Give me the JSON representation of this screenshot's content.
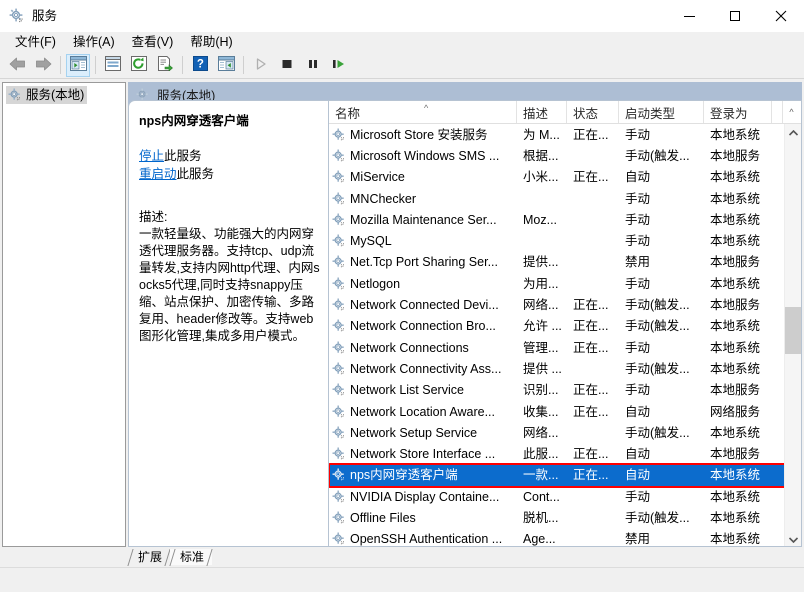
{
  "window": {
    "title": "服务",
    "icon": "services-gear-icon",
    "minimize": "−",
    "maximize": "□",
    "close": "✕"
  },
  "menubar": {
    "items": [
      {
        "label": "文件(F)",
        "name": "menu-file"
      },
      {
        "label": "操作(A)",
        "name": "menu-action"
      },
      {
        "label": "查看(V)",
        "name": "menu-view"
      },
      {
        "label": "帮助(H)",
        "name": "menu-help"
      }
    ]
  },
  "toolbar": {
    "buttons": [
      {
        "name": "back-icon",
        "title": "后退"
      },
      {
        "name": "forward-icon",
        "title": "前进"
      },
      {
        "name": "show-tree-icon",
        "title": "显示/隐藏控制台树"
      },
      {
        "name": "properties-icon",
        "title": "属性"
      },
      {
        "name": "refresh-icon",
        "title": "刷新"
      },
      {
        "name": "export-list-icon",
        "title": "导出列表"
      },
      {
        "name": "help-icon",
        "title": "帮助"
      },
      {
        "name": "show-action-pane-icon",
        "title": "显示/隐藏操作窗格"
      },
      {
        "name": "start-service-icon",
        "title": "启动服务"
      },
      {
        "name": "stop-service-icon",
        "title": "停止服务"
      },
      {
        "name": "pause-service-icon",
        "title": "暂停服务"
      },
      {
        "name": "restart-service-icon",
        "title": "重启动服务"
      }
    ]
  },
  "tree": {
    "root_label": "服务(本地)",
    "root_icon": "services-gear-icon"
  },
  "pane": {
    "header_label": "服务(本地)",
    "header_icon": "services-gear-icon"
  },
  "details": {
    "service_name": "nps内网穿透客户端",
    "links": [
      {
        "link_text": "停止",
        "suffix": "此服务",
        "name": "stop-service-link"
      },
      {
        "link_text": "重启动",
        "suffix": "此服务",
        "name": "restart-service-link"
      }
    ],
    "description_label": "描述:",
    "description_text": "一款轻量级、功能强大的内网穿透代理服务器。支持tcp、udp流量转发,支持内网http代理、内网socks5代理,同时支持snappy压缩、站点保护、加密传输、多路复用、header修改等。支持web图形化管理,集成多用户模式。"
  },
  "list": {
    "columns": [
      {
        "key": "name",
        "label": "名称",
        "sorted": "asc",
        "sort_glyph": "^"
      },
      {
        "key": "desc",
        "label": "描述"
      },
      {
        "key": "state",
        "label": "状态"
      },
      {
        "key": "start",
        "label": "启动类型"
      },
      {
        "key": "logon",
        "label": "登录为"
      }
    ],
    "scroll_cap_glyph": "^",
    "rows": [
      {
        "name": "Microsoft Store 安装服务",
        "desc": "为 M...",
        "state": "正在...",
        "start": "手动",
        "logon": "本地系统",
        "selected": false
      },
      {
        "name": "Microsoft Windows SMS ...",
        "desc": "根据...",
        "state": "",
        "start": "手动(触发...",
        "logon": "本地服务",
        "selected": false
      },
      {
        "name": "MiService",
        "desc": "小米...",
        "state": "正在...",
        "start": "自动",
        "logon": "本地系统",
        "selected": false
      },
      {
        "name": "MNChecker",
        "desc": "",
        "state": "",
        "start": "手动",
        "logon": "本地系统",
        "selected": false
      },
      {
        "name": "Mozilla Maintenance Ser...",
        "desc": "Moz...",
        "state": "",
        "start": "手动",
        "logon": "本地系统",
        "selected": false
      },
      {
        "name": "MySQL",
        "desc": "",
        "state": "",
        "start": "手动",
        "logon": "本地系统",
        "selected": false
      },
      {
        "name": "Net.Tcp Port Sharing Ser...",
        "desc": "提供...",
        "state": "",
        "start": "禁用",
        "logon": "本地服务",
        "selected": false
      },
      {
        "name": "Netlogon",
        "desc": "为用...",
        "state": "",
        "start": "手动",
        "logon": "本地系统",
        "selected": false
      },
      {
        "name": "Network Connected Devi...",
        "desc": "网络...",
        "state": "正在...",
        "start": "手动(触发...",
        "logon": "本地服务",
        "selected": false
      },
      {
        "name": "Network Connection Bro...",
        "desc": "允许 ...",
        "state": "正在...",
        "start": "手动(触发...",
        "logon": "本地系统",
        "selected": false
      },
      {
        "name": "Network Connections",
        "desc": "管理...",
        "state": "正在...",
        "start": "手动",
        "logon": "本地系统",
        "selected": false
      },
      {
        "name": "Network Connectivity Ass...",
        "desc": "提供 ...",
        "state": "",
        "start": "手动(触发...",
        "logon": "本地系统",
        "selected": false
      },
      {
        "name": "Network List Service",
        "desc": "识别...",
        "state": "正在...",
        "start": "手动",
        "logon": "本地服务",
        "selected": false
      },
      {
        "name": "Network Location Aware...",
        "desc": "收集...",
        "state": "正在...",
        "start": "自动",
        "logon": "网络服务",
        "selected": false
      },
      {
        "name": "Network Setup Service",
        "desc": "网络...",
        "state": "",
        "start": "手动(触发...",
        "logon": "本地系统",
        "selected": false
      },
      {
        "name": "Network Store Interface ...",
        "desc": "此服...",
        "state": "正在...",
        "start": "自动",
        "logon": "本地服务",
        "selected": false
      },
      {
        "name": "nps内网穿透客户端",
        "desc": "一款...",
        "state": "正在...",
        "start": "自动",
        "logon": "本地系统",
        "selected": true
      },
      {
        "name": "NVIDIA Display Containe...",
        "desc": "Cont...",
        "state": "",
        "start": "手动",
        "logon": "本地系统",
        "selected": false
      },
      {
        "name": "Offline Files",
        "desc": "脱机...",
        "state": "",
        "start": "手动(触发...",
        "logon": "本地系统",
        "selected": false
      },
      {
        "name": "OpenSSH Authentication ...",
        "desc": "Age...",
        "state": "",
        "start": "禁用",
        "logon": "本地系统",
        "selected": false
      }
    ]
  },
  "tabs": [
    {
      "label": "扩展",
      "name": "tab-extended",
      "selected": false
    },
    {
      "label": "标准",
      "name": "tab-standard",
      "selected": true
    }
  ],
  "colors": {
    "selection_blue": "#0c6ccd",
    "pane_header": "#adbed4",
    "annotation_red": "#ff0000",
    "link_blue": "#0066cc"
  }
}
